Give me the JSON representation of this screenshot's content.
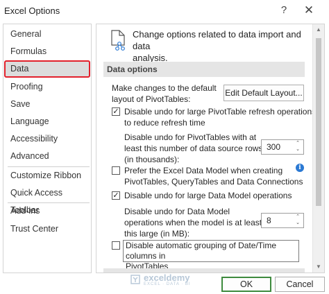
{
  "window": {
    "title": "Excel Options",
    "help_glyph": "?",
    "close_glyph": "✕"
  },
  "sidebar": {
    "items": [
      {
        "label": "General"
      },
      {
        "label": "Formulas"
      },
      {
        "label": "Data",
        "selected": true
      },
      {
        "label": "Proofing"
      },
      {
        "label": "Save"
      },
      {
        "label": "Language"
      },
      {
        "label": "Accessibility"
      },
      {
        "label": "Advanced"
      },
      {
        "label": "Customize Ribbon"
      },
      {
        "label": "Quick Access Toolbar"
      },
      {
        "label": "Add-ins"
      },
      {
        "label": "Trust Center"
      }
    ]
  },
  "header": {
    "text_line1": "Change options related to data import and data",
    "text_line2": "analysis."
  },
  "data_options": {
    "section_title": "Data options",
    "default_layout_label_line1": "Make changes to the default",
    "default_layout_label_line2": "layout of PivotTables:",
    "edit_default_layout_button": "Edit Default Layout...",
    "disable_undo_pivot": {
      "checked": true,
      "line1": "Disable undo for large PivotTable refresh operations",
      "line2": "to reduce refresh time"
    },
    "pivot_rows_label_line1": "Disable undo for PivotTables with at",
    "pivot_rows_label_line2": "least this number of data source rows",
    "pivot_rows_label_line3": "(in thousands):",
    "pivot_rows_value": "300",
    "prefer_data_model": {
      "checked": false,
      "line1": "Prefer the Excel Data Model when creating",
      "line2": "PivotTables, QueryTables and Data Connections"
    },
    "info_glyph": "i",
    "disable_undo_model": {
      "checked": true,
      "line1": "Disable undo for large Data Model operations"
    },
    "model_size_label_line1": "Disable undo for Data Model",
    "model_size_label_line2": "operations when the model is at least",
    "model_size_label_line3": "this large (in MB):",
    "model_size_value": "8",
    "disable_grouping": {
      "checked": false,
      "line1": "Disable automatic grouping of Date/Time columns in",
      "line2": "PivotTables"
    }
  },
  "watermark": {
    "name": "exceldemy",
    "tagline": "EXCEL · DATA · BI"
  },
  "footer": {
    "ok_label": "OK",
    "cancel_label": "Cancel"
  },
  "glyphs": {
    "check": "✓",
    "spin_up": "⌃",
    "spin_down": "⌄",
    "scroll_up": "▲",
    "scroll_down": "▼"
  },
  "colors": {
    "selection_outline": "#e2202b",
    "ok_border": "#3d8a3d",
    "info_blue": "#2b79d3",
    "section_bg": "#e5e5e5"
  }
}
